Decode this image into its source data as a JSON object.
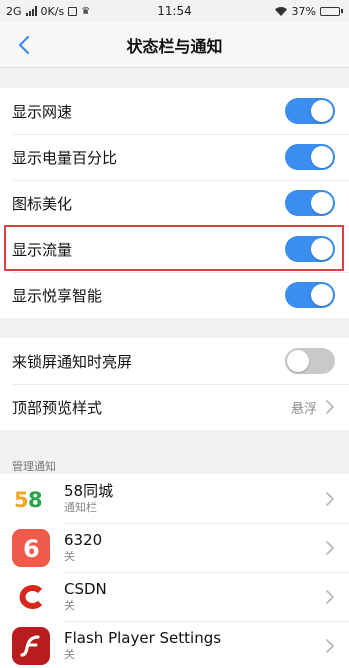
{
  "status_bar": {
    "network": "2G",
    "speed": "0K/s",
    "time": "11:54",
    "battery_text": "37%",
    "battery_level": 0.37
  },
  "nav": {
    "title": "状态栏与通知"
  },
  "settings": [
    {
      "label": "显示网速",
      "on": true
    },
    {
      "label": "显示电量百分比",
      "on": true
    },
    {
      "label": "图标美化",
      "on": true
    },
    {
      "label": "显示流量",
      "on": true
    },
    {
      "label": "显示悦享智能",
      "on": true
    }
  ],
  "lock_group": {
    "lockscreen_wake": {
      "label": "来锁屏通知时亮屏",
      "on": false
    },
    "preview_style": {
      "label": "顶部预览样式",
      "value": "悬浮"
    }
  },
  "manage": {
    "header": "管理通知",
    "apps": [
      {
        "name": "58同城",
        "status": "通知栏",
        "icon": "58-logo-icon"
      },
      {
        "name": "6320",
        "status": "关",
        "icon": "6320-logo-icon"
      },
      {
        "name": "CSDN",
        "status": "关",
        "icon": "csdn-logo-icon"
      },
      {
        "name": "Flash Player Settings",
        "status": "关",
        "icon": "flash-player-icon"
      }
    ]
  },
  "colors": {
    "accent": "#3b8ef0",
    "toggle_off": "#c9c9c9",
    "highlight": "#e04040"
  }
}
